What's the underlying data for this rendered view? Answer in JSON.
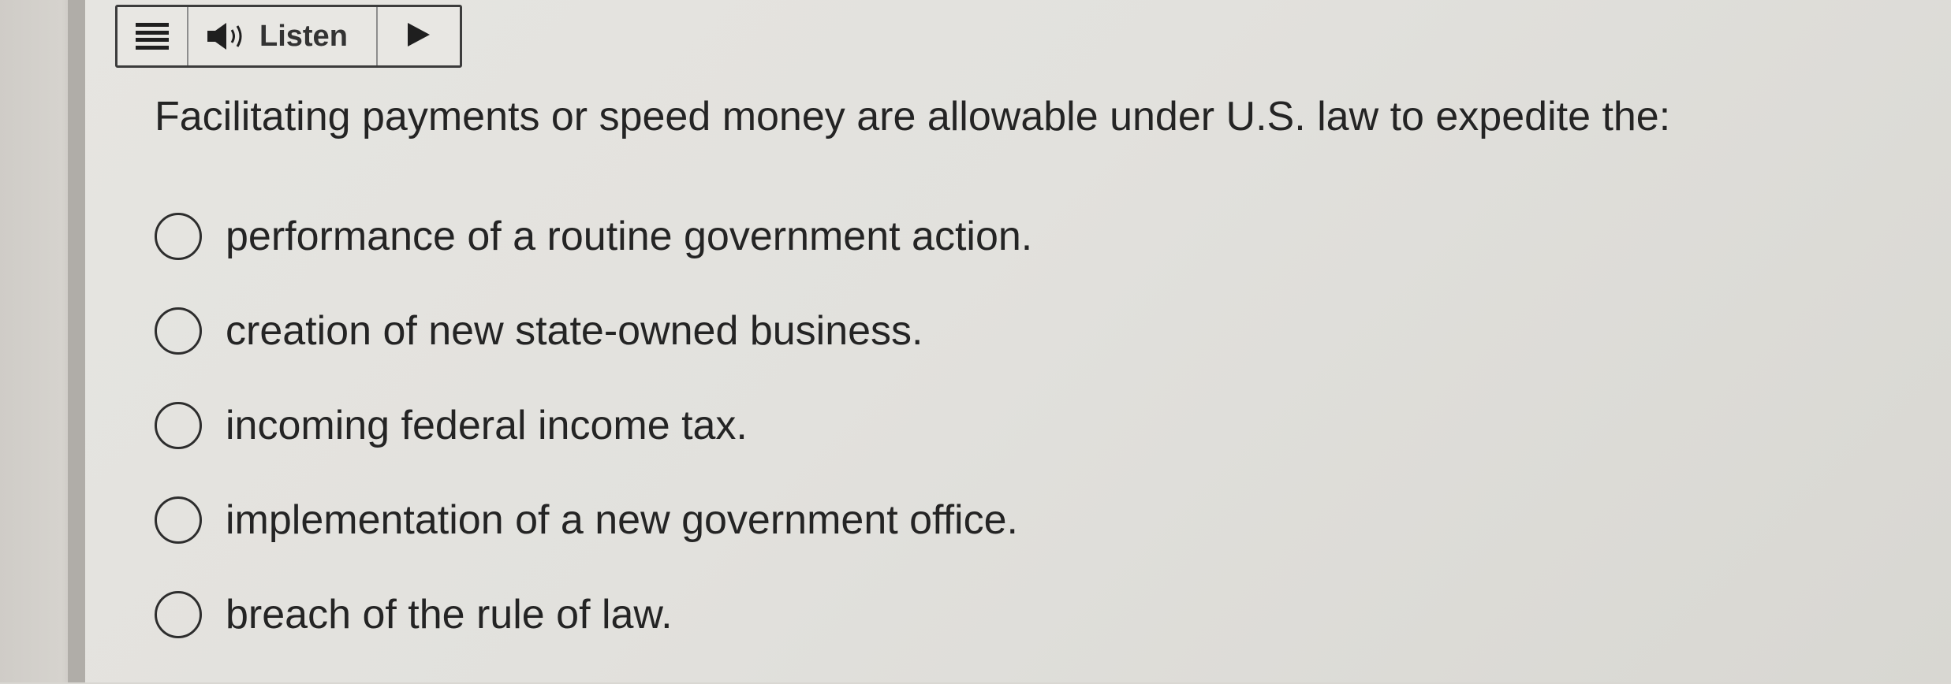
{
  "toolbar": {
    "menu_icon": "hamburger-menu-icon",
    "speaker_icon": "speaker-icon",
    "listen_label": "Listen",
    "play_icon": "play-icon"
  },
  "question": {
    "text": "Facilitating payments or speed money are allowable under U.S. law to expedite the:"
  },
  "options": [
    {
      "label": "performance of a routine government action.",
      "selected": false
    },
    {
      "label": "creation of new state-owned business.",
      "selected": false
    },
    {
      "label": "incoming federal income tax.",
      "selected": false
    },
    {
      "label": "implementation of a new government office.",
      "selected": false
    },
    {
      "label": "breach of the rule of law.",
      "selected": false
    }
  ],
  "colors": {
    "text": "#242424",
    "border": "#2d2d2d",
    "background": "#e3e2de"
  }
}
